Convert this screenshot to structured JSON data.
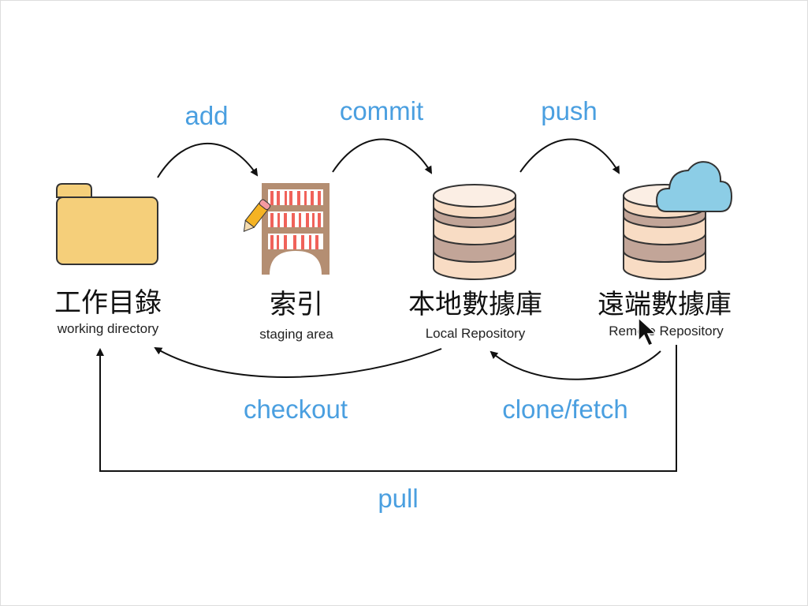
{
  "nodes": [
    {
      "title": "工作目錄",
      "subtitle": "working directory",
      "icon": "folder-icon"
    },
    {
      "title": "索引",
      "subtitle": "staging area",
      "icon": "bookshelf-icon"
    },
    {
      "title": "本地數據庫",
      "subtitle": "Local Repository",
      "icon": "database-icon"
    },
    {
      "title": "遠端數據庫",
      "subtitle": "Remote Repository",
      "icon": "cloud-database-icon"
    }
  ],
  "operations": {
    "add": "add",
    "commit": "commit",
    "push": "push",
    "checkout": "checkout",
    "clone_fetch": "clone/fetch",
    "pull": "pull"
  },
  "colors": {
    "operation_text": "#4a9fe0",
    "folder": "#f5cf7a",
    "cloud": "#8ccde6",
    "db_light": "#f8dcc4",
    "db_dark": "#c2a598",
    "shelf": "#b48e72",
    "books": "#f0625a"
  }
}
